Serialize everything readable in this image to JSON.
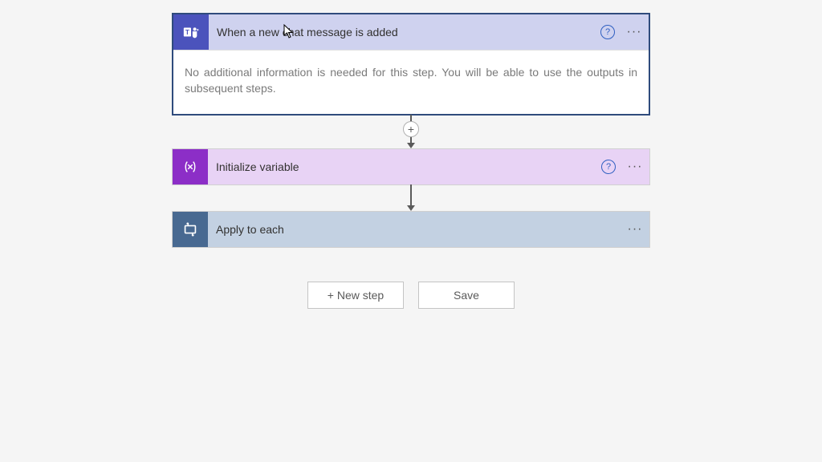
{
  "steps": {
    "trigger": {
      "title": "When a new chat message is added",
      "body": "No additional information is needed for this step. You will be able to use the outputs in subsequent steps."
    },
    "variable": {
      "title": "Initialize variable"
    },
    "apply": {
      "title": "Apply to each"
    }
  },
  "buttons": {
    "new_step": "+ New step",
    "save": "Save"
  },
  "icons": {
    "help": "?",
    "more": "···",
    "add": "+"
  }
}
